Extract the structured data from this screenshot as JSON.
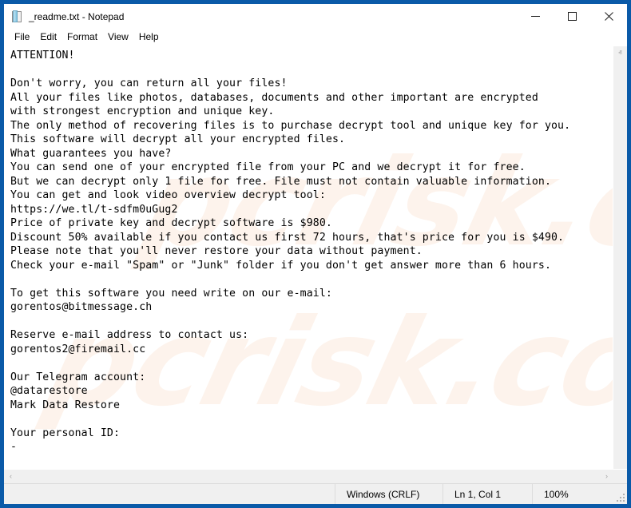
{
  "window": {
    "title": "_readme.txt - Notepad",
    "icon": "notepad-icon",
    "border_color": "#0a5aa8",
    "controls": {
      "minimize": "–",
      "maximize": "□",
      "close": "✕"
    }
  },
  "menubar": {
    "items": [
      {
        "label": "File"
      },
      {
        "label": "Edit"
      },
      {
        "label": "Format"
      },
      {
        "label": "View"
      },
      {
        "label": "Help"
      }
    ]
  },
  "document": {
    "filename": "_readme.txt",
    "watermark_text": "pcrisk.com",
    "body": "ATTENTION!\n\nDon't worry, you can return all your files!\nAll your files like photos, databases, documents and other important are encrypted\nwith strongest encryption and unique key.\nThe only method of recovering files is to purchase decrypt tool and unique key for you.\nThis software will decrypt all your encrypted files.\nWhat guarantees you have?\nYou can send one of your encrypted file from your PC and we decrypt it for free.\nBut we can decrypt only 1 file for free. File must not contain valuable information.\nYou can get and look video overview decrypt tool:\nhttps://we.tl/t-sdfm0uGug2\nPrice of private key and decrypt software is $980.\nDiscount 50% available if you contact us first 72 hours, that's price for you is $490.\nPlease note that you'll never restore your data without payment.\nCheck your e-mail \"Spam\" or \"Junk\" folder if you don't get answer more than 6 hours.\n\nTo get this software you need write on our e-mail:\ngorentos@bitmessage.ch\n\nReserve e-mail address to contact us:\ngorentos2@firemail.cc\n\nOur Telegram account:\n@datarestore\nMark Data Restore\n\nYour personal ID:\n-",
    "details": {
      "video_url": "https://we.tl/t-sdfm0uGug2",
      "price_full": "$980",
      "price_discount": "$490",
      "discount_percent": "50%",
      "discount_window_hours": "72 hours",
      "response_time": "6 hours",
      "email_primary": "gorentos@bitmessage.ch",
      "email_reserve": "gorentos2@firemail.cc",
      "telegram_account": "@datarestore",
      "telegram_name": "Mark Data Restore",
      "personal_id": "-"
    }
  },
  "scrollbars": {
    "vertical": {
      "up_arrow": "ⱏ",
      "down_arrow": "ⱟ"
    },
    "horizontal": {
      "left_arrow": "‹",
      "right_arrow": "›"
    }
  },
  "statusbar": {
    "line_ending": "Windows (CRLF)",
    "cursor_position": "Ln 1, Col 1",
    "zoom": "100%"
  }
}
